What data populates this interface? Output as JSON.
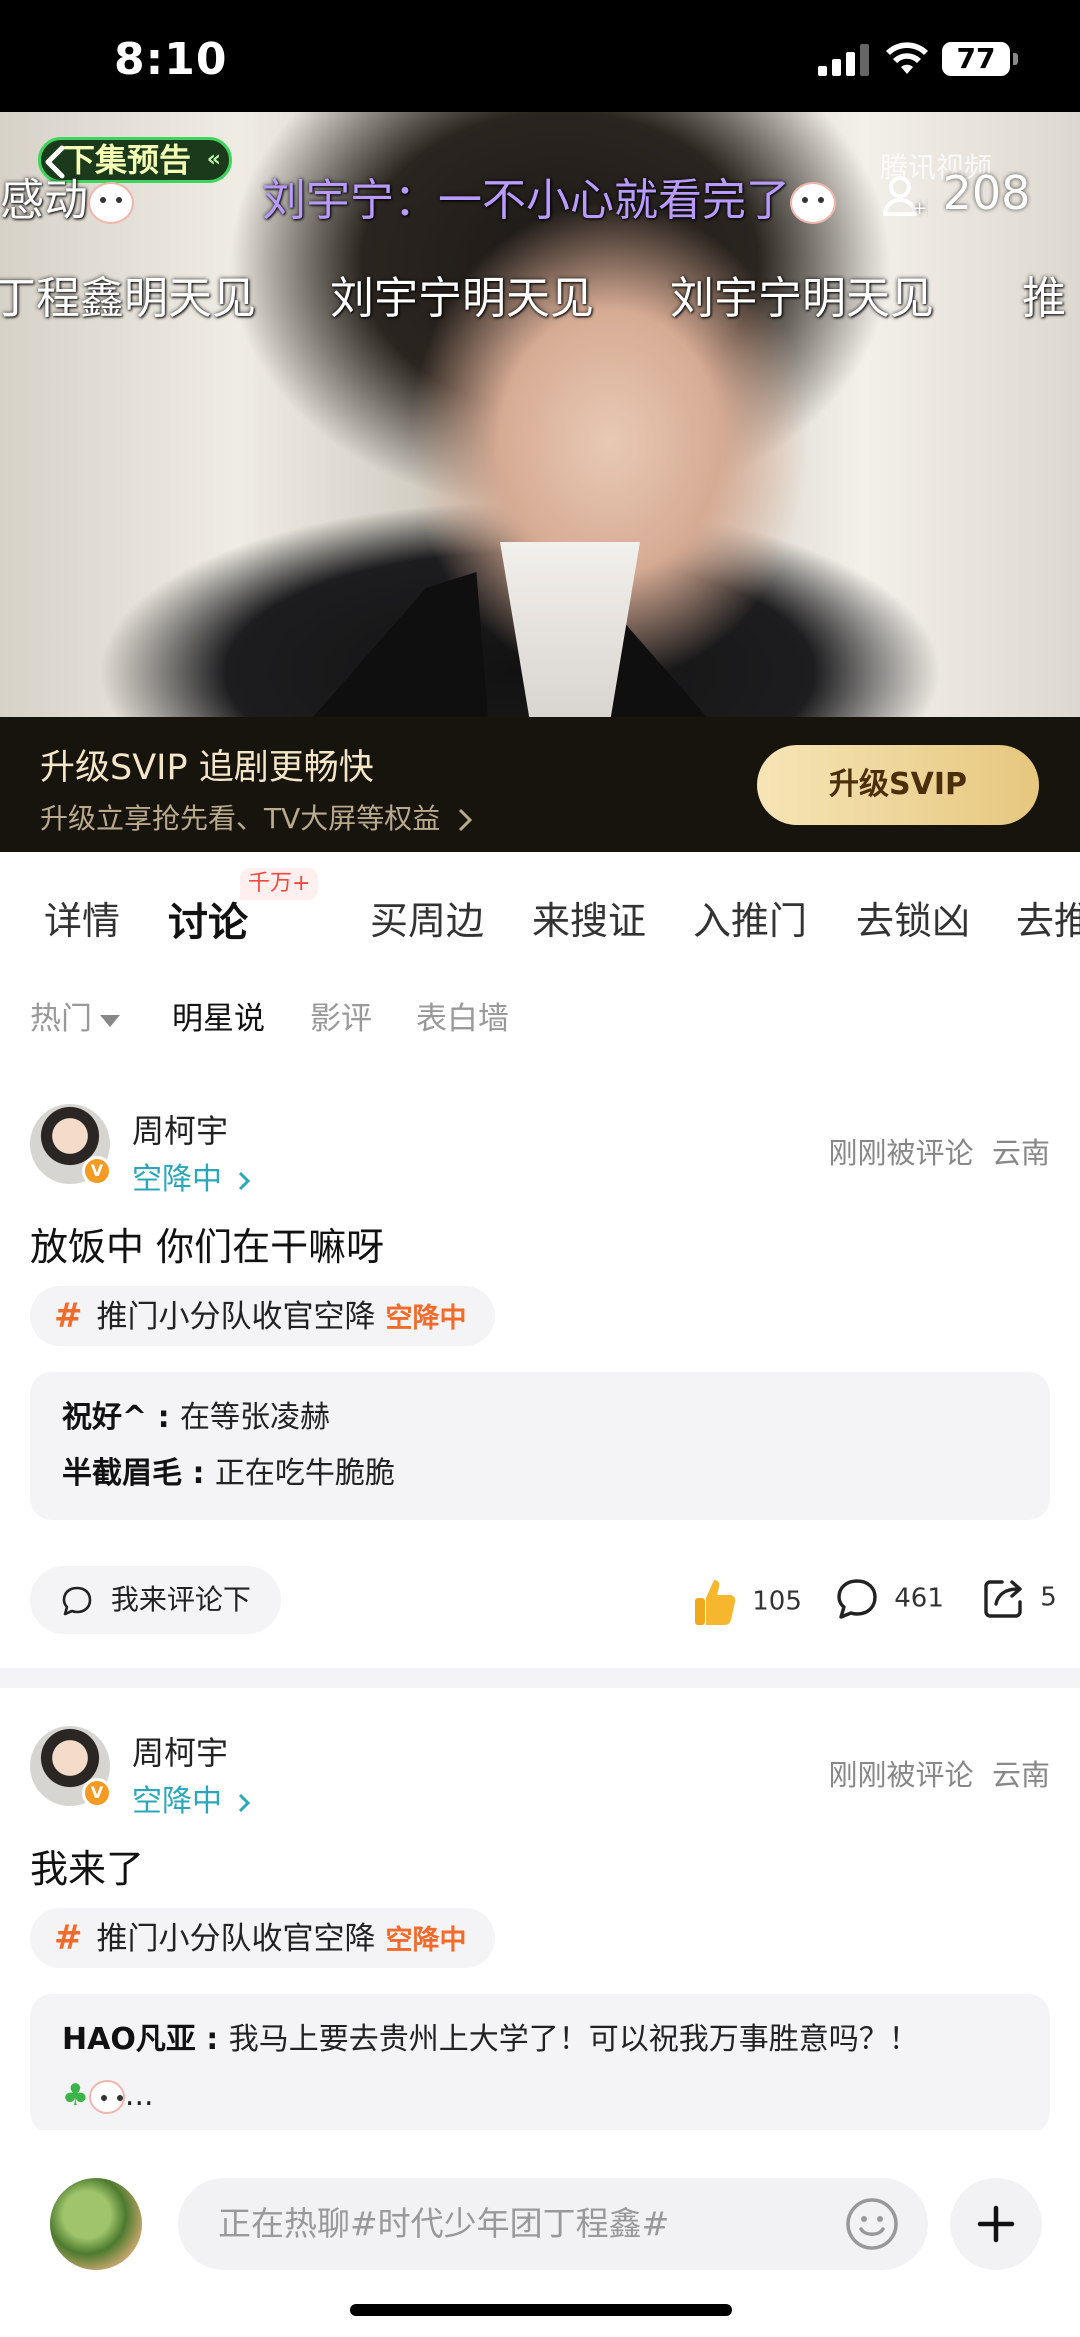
{
  "status_bar": {
    "time": "8:10",
    "battery": "77"
  },
  "video": {
    "preview_badge": "下集预告",
    "danmu": {
      "row1_left": "感动",
      "row1_center": "刘宇宁：一不小心就看完了",
      "row2": [
        "丁程鑫明天见",
        "刘宇宁明天见",
        "刘宇宁明天见",
        "推"
      ]
    },
    "watermark": "腾讯视频",
    "viewer_count": "208"
  },
  "svip_banner": {
    "title": "升级SVIP 追剧更畅快",
    "subtitle": "升级立享抢先看、TV大屏等权益",
    "button": "升级SVIP"
  },
  "tabs": [
    {
      "label": "详情"
    },
    {
      "label": "讨论",
      "active": true,
      "badge": "千万+"
    },
    {
      "label": "买周边"
    },
    {
      "label": "来搜证"
    },
    {
      "label": "入推门"
    },
    {
      "label": "去锁凶"
    },
    {
      "label": "去推"
    }
  ],
  "subtabs": [
    {
      "label": "热门"
    },
    {
      "label": "明星说",
      "active": true
    },
    {
      "label": "影评"
    },
    {
      "label": "表白墙"
    }
  ],
  "posts": [
    {
      "username": "周柯宇",
      "status": "空降中",
      "meta_time": "刚刚被评论",
      "meta_location": "云南",
      "content": "放饭中 你们在干嘛呀",
      "hashtag": "推门小分队收官空降",
      "hashtag_hot": "空降中",
      "replies": [
        {
          "name": "祝好^",
          "text": "在等张凌赫"
        },
        {
          "name": "半截眉毛",
          "text": "正在吃牛脆脆"
        }
      ],
      "comment_button": "我来评论下",
      "likes": "105",
      "comments": "461",
      "shares": "5"
    },
    {
      "username": "周柯宇",
      "status": "空降中",
      "meta_time": "刚刚被评论",
      "meta_location": "云南",
      "content": "我来了",
      "hashtag": "推门小分队收官空降",
      "hashtag_hot": "空降中",
      "replies": [
        {
          "name": "HAO凡亚",
          "text": "我马上要去贵州上大学了！可以祝我万事胜意吗？！"
        }
      ],
      "reply_more": "..."
    }
  ],
  "bottom_bar": {
    "input_placeholder": "正在热聊#时代少年团丁程鑫#"
  },
  "colors": {
    "accent_orange": "#f26b2b",
    "status_teal": "#2aa7b8",
    "svip_gold": "#e6c77e",
    "badge_red": "#f04a3e"
  }
}
